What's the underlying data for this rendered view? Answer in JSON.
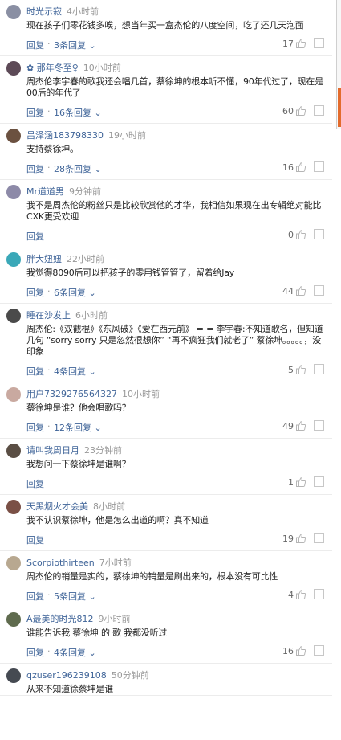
{
  "reply_label": "回复",
  "comments": [
    {
      "user": "时光示寂",
      "time": "4小时前",
      "text": "现在孩子们零花钱多唉，想当年买一盒杰伦的八度空间，吃了还几天泡面",
      "replies": "3条回复",
      "likes": "17",
      "avatar_color": "#8a8fa3"
    },
    {
      "user": "✿ 那年冬至♀",
      "time": "10小时前",
      "text": "周杰伦李宇春的歌我还会唱几首，蔡徐坤的根本听不懂，90年代过了，现在是00后的年代了",
      "replies": "16条回复",
      "likes": "60",
      "avatar_color": "#5d4a57"
    },
    {
      "user": "吕泽涵183798330",
      "time": "19小时前",
      "text": "支持蔡徐坤。",
      "replies": "28条回复",
      "likes": "16",
      "avatar_color": "#6b5140"
    },
    {
      "user": "Mr道道男",
      "time": "9分钟前",
      "text": "我不是周杰伦的粉丝只是比较欣赏他的才华，我相信如果现在出专辑绝对能比CXK更受欢迎",
      "replies": "",
      "likes": "0",
      "avatar_color": "#8d8aa8"
    },
    {
      "user": "胖大妞妞",
      "time": "22小时前",
      "text": "我觉得8090后可以把孩子的零用钱管管了，留着给Jay",
      "replies": "6条回复",
      "likes": "44",
      "avatar_color": "#3aa8b8"
    },
    {
      "user": "睡在沙发上",
      "time": "6小时前",
      "text": "周杰伦:《双截棍》《东风破》《爱在西元前》 = = 李宇春:不知道歌名，但知道几句 “sorry sorry 只是忽然很想你” “再不疯狂我们就老了” 蔡徐坤。。。。。，没印象",
      "replies": "4条回复",
      "likes": "5",
      "avatar_color": "#4a4a4a"
    },
    {
      "user": "用户7329276564327",
      "time": "10小时前",
      "text": "蔡徐坤是谁？他会唱歌吗？",
      "replies": "12条回复",
      "likes": "49",
      "avatar_color": "#c9a9a0"
    },
    {
      "user": "请叫我周日月",
      "time": "23分钟前",
      "text": "我想问一下蔡徐坤是谁啊？",
      "replies": "",
      "likes": "1",
      "avatar_color": "#5a4e44"
    },
    {
      "user": "天黑烟火才会美",
      "time": "8小时前",
      "text": "我不认识蔡徐坤，他是怎么出道的啊？真不知道",
      "replies": "",
      "likes": "19",
      "avatar_color": "#7a5046"
    },
    {
      "user": "Scorpiothirteen",
      "time": "7小时前",
      "text": "周杰伦的销量是实的，蔡徐坤的销量是刷出来的，根本没有可比性",
      "replies": "5条回复",
      "likes": "4",
      "avatar_color": "#b8a890"
    },
    {
      "user": "A最美的时光812",
      "time": "9小时前",
      "text": "谁能告诉我 蔡徐坤 的 歌 我都没听过",
      "replies": "4条回复",
      "likes": "16",
      "avatar_color": "#5f6b4e"
    },
    {
      "user": "qzuser196239108",
      "time": "50分钟前",
      "text": "从来不知道徐蔡坤是谁",
      "replies": "",
      "likes": "",
      "avatar_color": "#454a52"
    }
  ],
  "colors": {
    "link": "#406599",
    "accent_tab": "#e36b2c"
  }
}
